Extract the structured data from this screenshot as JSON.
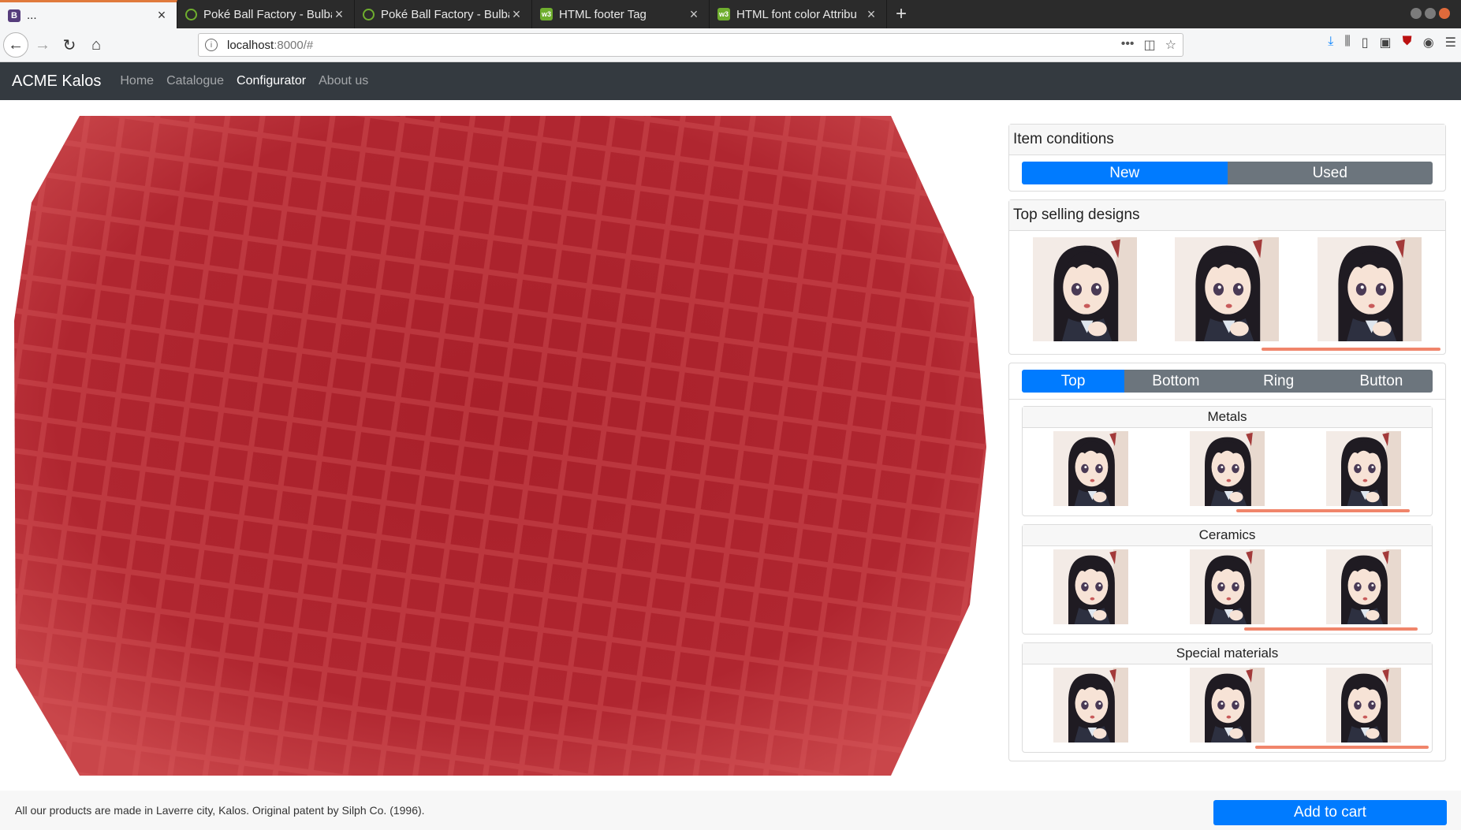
{
  "browser": {
    "tabs": [
      {
        "title": "...",
        "icon": "bootstrap-icon",
        "active": true
      },
      {
        "title": "Poké Ball Factory - Bulba",
        "icon": "bulbapedia-icon",
        "active": false
      },
      {
        "title": "Poké Ball Factory - Bulba",
        "icon": "bulbapedia-icon",
        "active": false
      },
      {
        "title": "HTML footer Tag",
        "icon": "w3schools-icon",
        "active": false
      },
      {
        "title": "HTML font color Attribu",
        "icon": "w3schools-icon",
        "active": false
      }
    ],
    "new_tab": "+",
    "url_host": "localhost",
    "url_path": ":8000/#"
  },
  "site": {
    "brand": "ACME Kalos",
    "nav": [
      {
        "label": "Home",
        "active": false
      },
      {
        "label": "Catalogue",
        "active": false
      },
      {
        "label": "Configurator",
        "active": true
      },
      {
        "label": "About us",
        "active": false
      }
    ]
  },
  "viewer": {
    "object_color": "#a8202a"
  },
  "conditions": {
    "title": "Item conditions",
    "options": [
      {
        "label": "New",
        "selected": true
      },
      {
        "label": "Used",
        "selected": false
      }
    ]
  },
  "top_selling": {
    "title": "Top selling designs",
    "items": [
      "design-1",
      "design-2",
      "design-3"
    ],
    "scroll_fraction": 0.42
  },
  "parts": {
    "tabs": [
      {
        "label": "Top",
        "selected": true
      },
      {
        "label": "Bottom",
        "selected": false
      },
      {
        "label": "Ring",
        "selected": false
      },
      {
        "label": "Button",
        "selected": false
      }
    ],
    "groups": [
      {
        "title": "Metals",
        "items": [
          "metal-1",
          "metal-2",
          "metal-3"
        ]
      },
      {
        "title": "Ceramics",
        "items": [
          "ceramic-1",
          "ceramic-2",
          "ceramic-3"
        ]
      },
      {
        "title": "Special materials",
        "items": [
          "special-1",
          "special-2",
          "special-3"
        ]
      }
    ]
  },
  "footer": {
    "text": "All our products are made in Laverre city, Kalos. Original patent by Silph Co. (1996).",
    "cart_label": "Add to cart"
  },
  "colors": {
    "navbar": "#343a40",
    "primary": "#007bff",
    "secondary": "#6c757d",
    "accent_scroll": "#f0856b"
  }
}
